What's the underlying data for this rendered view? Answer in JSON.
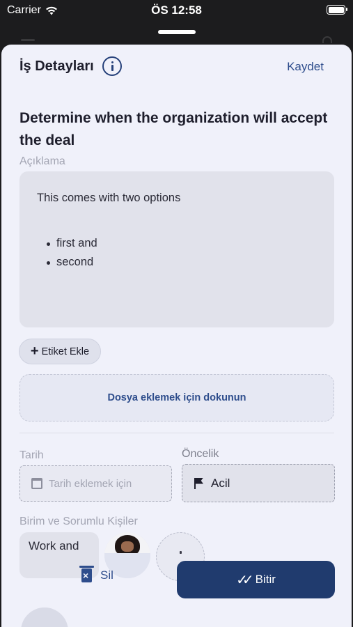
{
  "status_bar": {
    "carrier": "Carrier",
    "time": "ÖS 12:58"
  },
  "header": {
    "title": "İş Detayları",
    "save_label": "Kaydet"
  },
  "task": {
    "title": "Determine when the organization will accept the deal",
    "description_label": "Açıklama",
    "description_text": "This comes with two options",
    "description_items": [
      "first and",
      "second"
    ]
  },
  "tag_button_label": "Etiket Ekle",
  "file_upload_label": "Dosya eklemek için dokunun",
  "date": {
    "label": "Tarih",
    "placeholder": "Tarih eklemek için"
  },
  "priority": {
    "label": "Öncelik",
    "value": "Acil"
  },
  "assignees": {
    "label": "Birim ve Sorumlu Kişiler",
    "unit_chip": "Work and"
  },
  "actions": {
    "delete_label": "Sil",
    "finish_label": "Bitir"
  },
  "colors": {
    "accent": "#2e4d8c",
    "primary_button": "#203b6e",
    "sheet_background": "#f0f1fa"
  }
}
